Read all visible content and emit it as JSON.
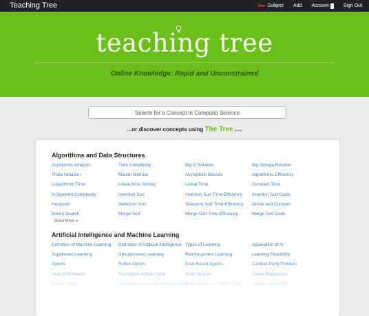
{
  "navbar": {
    "brand": "Teaching Tree",
    "badge": "New",
    "items": [
      "Subject",
      "Add",
      "Account",
      "Sign Out"
    ]
  },
  "hero": {
    "title": "teaching tree",
    "tagline": "Online Knowledge: Rapid and Unconstrained"
  },
  "search": {
    "placeholder": "Search for a Concept in Computer Science",
    "discover_prefix": "...or discover concepts using ",
    "tree_link": "The Tree",
    "beta": "(beta)"
  },
  "sections": [
    {
      "title": "Algorithms and Data Structures",
      "show_more": "Show More ▾",
      "concepts": [
        "Asymptotic Analysis",
        "Time Complexity",
        "Big O Notation",
        "Big Omega Notation",
        "Theta Notation",
        "Master Method",
        "Asymptotic Bounds",
        "Algorithmic Efficiency",
        "Logarithmic Time",
        "Linear-time Sorting",
        "Linear Time",
        "Constant Time",
        "N-Squared Complexity",
        "Insertion Sort",
        "Insertion Sort Time-Efficiency",
        "Insertion Sort Code",
        "Heapsort",
        "Selection Sort",
        "Selection Sort Time-Efficiency",
        "Divide and Conquer",
        "Binary Search",
        "Merge Sort",
        "Merge Sort Time-Efficiency",
        "Merge Sort Code"
      ]
    },
    {
      "title": "Artificial Intelligence and Machine Learning",
      "concepts": [
        "Definition of Machine Learning",
        "Definition of Artificial Intelligence",
        "Types of Learning",
        "Application of AI",
        "Supervised Learning",
        "Unsupervised Learning",
        "Reinforcement Learning",
        "Learning Feasibility",
        "Agents",
        "Reflex Agents",
        "Goal Based Agents",
        "Cocktail Party Problem",
        "Search Problems",
        "Perception-Action Cycle",
        "State Spaces",
        "Linear Regression",
        "Search Trees",
        "Parameters of a Learning Algorithm",
        "Wide Graph vs. Search Tree",
        "Search Algorithms"
      ]
    }
  ],
  "colors": {
    "hero_green": "#6cbf1b",
    "link_blue": "#3a7fc4",
    "navbar": "#222222"
  }
}
